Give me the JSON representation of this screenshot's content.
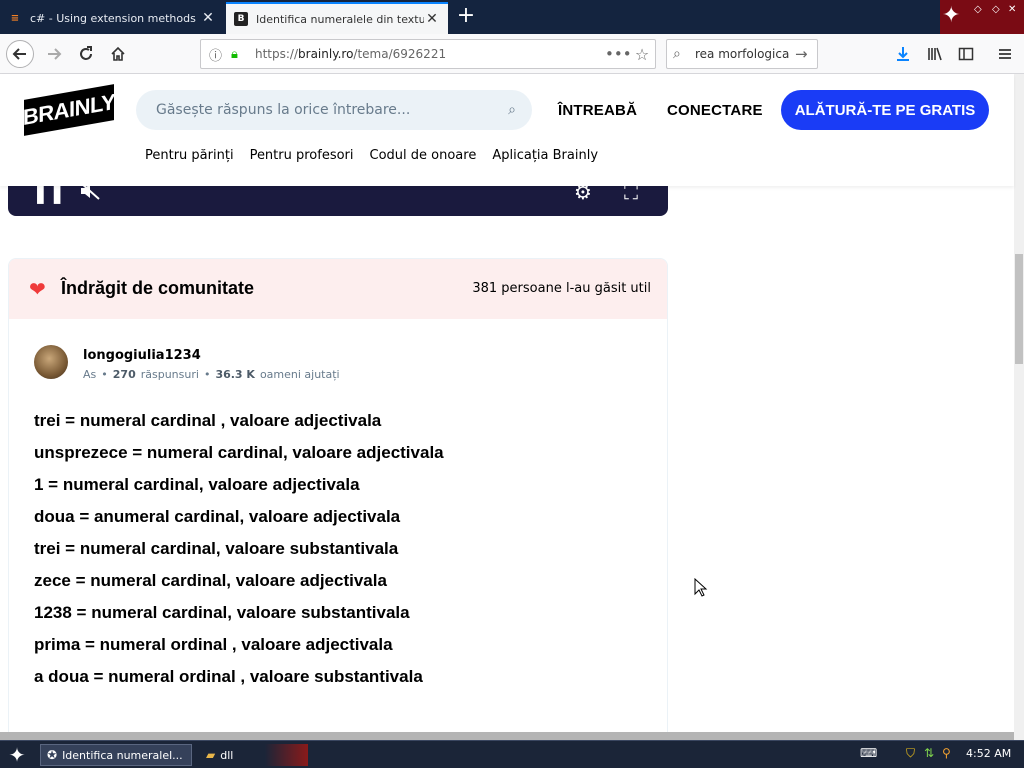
{
  "browser": {
    "tabs": [
      {
        "title": "c# - Using extension methods in .N",
        "active": false,
        "icon": "stackoverflow-icon"
      },
      {
        "title": "Identifica numeralele din textul de",
        "active": true,
        "icon": "brainly-icon"
      }
    ],
    "url_scheme": "https://",
    "url_host": "brainly.ro",
    "url_path": "/tema/6926221",
    "search_value": "rea morfologica"
  },
  "site": {
    "logo": "BRAINLY",
    "search_placeholder": "Găsește răspuns la orice întrebare...",
    "ask_label": "ÎNTREABĂ",
    "login_label": "CONECTARE",
    "join_label": "ALĂTURĂ-TE PE GRATIS",
    "subnav": [
      "Pentru părinți",
      "Pentru profesori",
      "Codul de onoare",
      "Aplicația Brainly"
    ],
    "accent_color": "#1a3cf6"
  },
  "answer_card": {
    "badge": "Îndrăgit de comunitate",
    "useful_count": "381 persoane l-au găsit util",
    "author": {
      "name": "longogiulia1234",
      "rank": "As",
      "answers_count": "270",
      "answers_label": "răspunsuri",
      "helped_count": "36.3 K",
      "helped_label": "oameni ajutați"
    },
    "lines": [
      "trei = numeral cardinal , valoare adjectivala",
      "unsprezece = numeral cardinal, valoare adjectivala",
      "1 = numeral cardinal, valoare adjectivala",
      "doua = anumeral cardinal, valoare adjectivala",
      "trei = numeral cardinal, valoare substantivala",
      "zece = numeral cardinal, valoare adjectivala",
      "1238 = numeral cardinal, valoare substantivala",
      "prima = numeral ordinal , valoare adjectivala",
      "a doua = numeral ordinal , valoare substantivala"
    ]
  },
  "taskbar": {
    "tasks": [
      "Identifica numeralel...",
      "dll"
    ],
    "clock": "4:52 AM"
  }
}
